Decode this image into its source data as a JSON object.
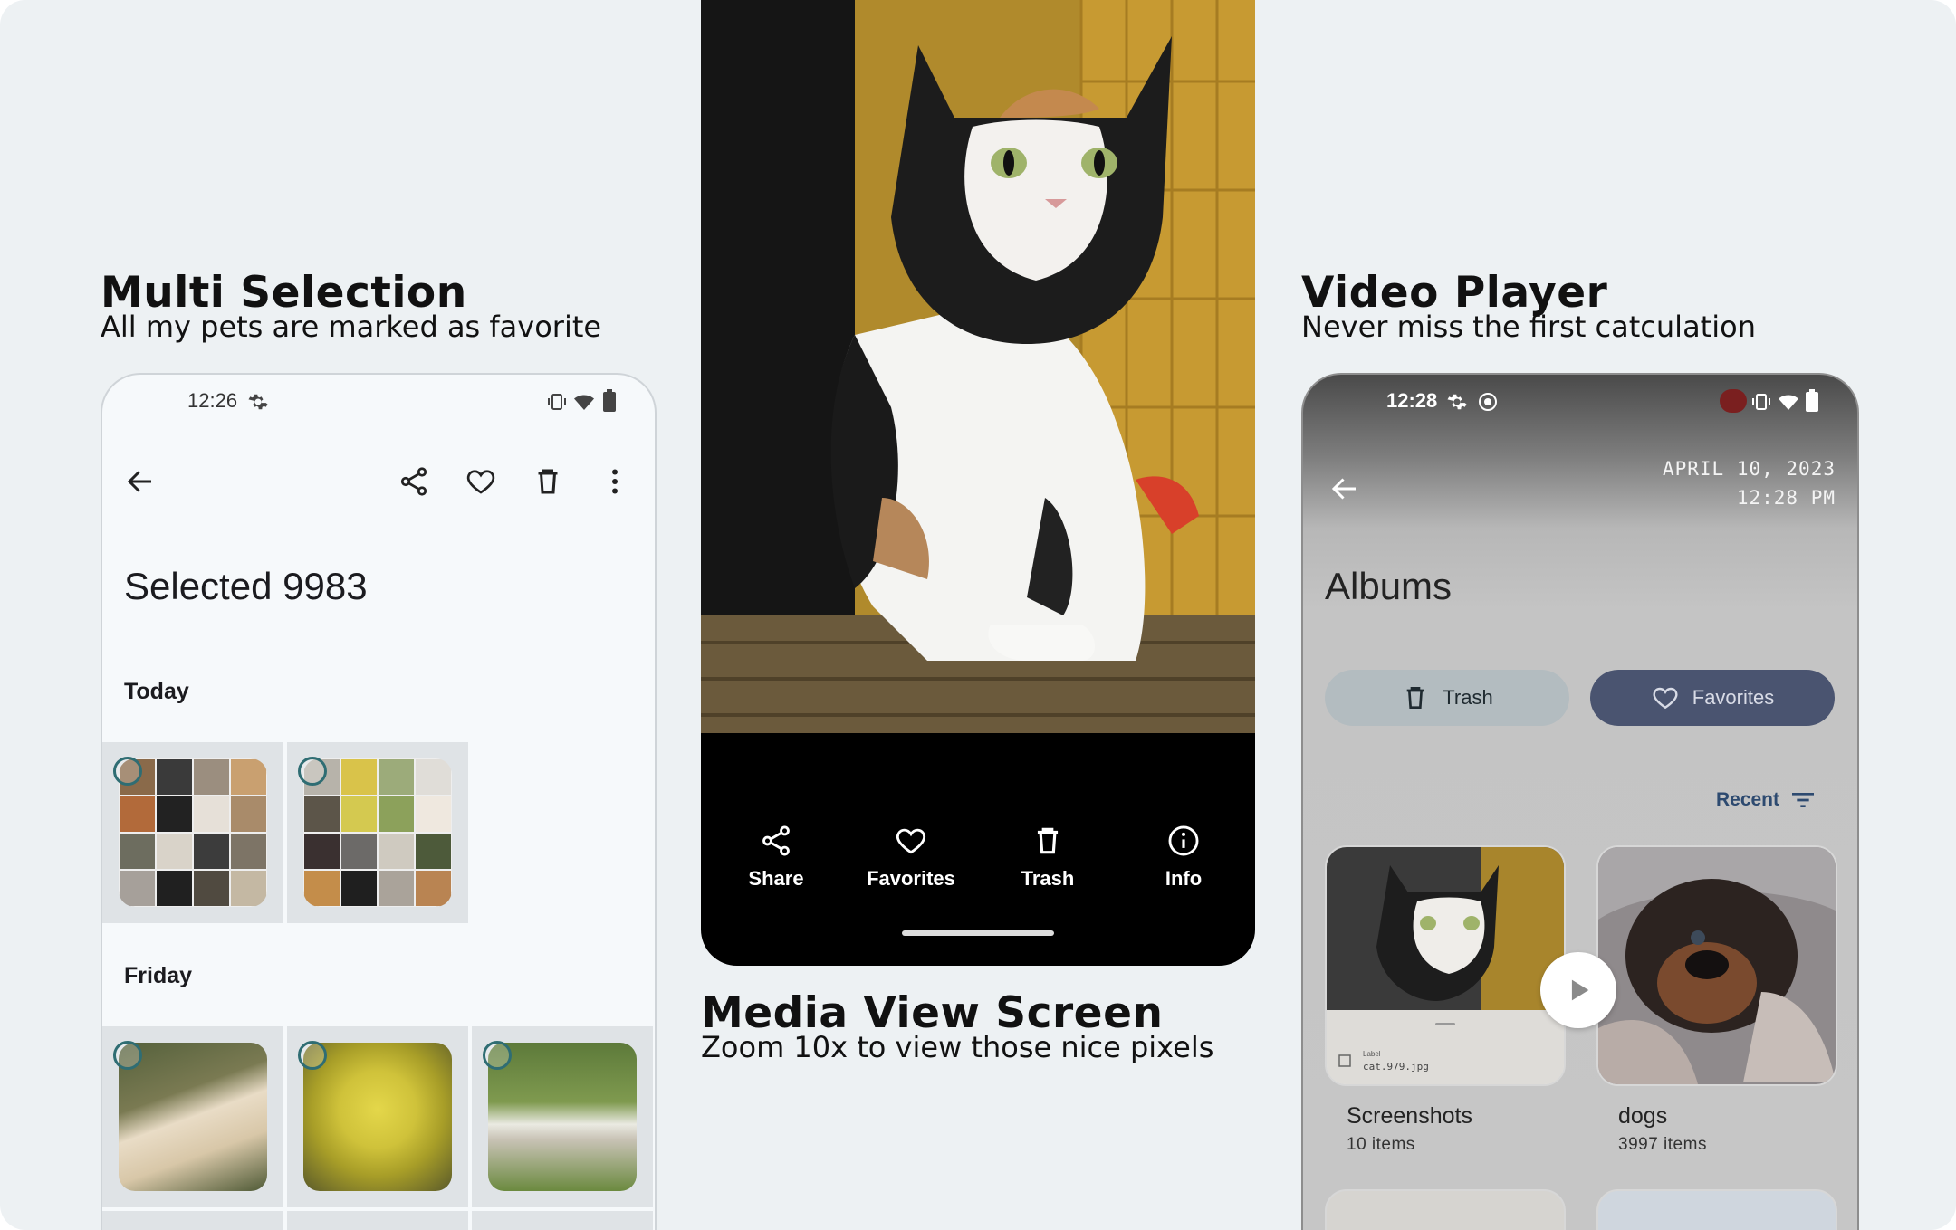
{
  "panels": {
    "left": {
      "title": "Multi Selection",
      "subtitle": "All my pets are marked as favorite"
    },
    "center": {
      "title": "Media View Screen",
      "subtitle": "Zoom 10x to view those nice pixels"
    },
    "right": {
      "title": "Video Player",
      "subtitle": "Never miss the first catculation"
    }
  },
  "selection_screen": {
    "status_time": "12:26",
    "title": "Selected 9983",
    "sections": [
      {
        "label": "Today",
        "items": [
          {
            "name": "pets-collage-1",
            "selected": true
          },
          {
            "name": "pets-collage-2",
            "selected": true
          }
        ]
      },
      {
        "label": "Friday",
        "items": [
          {
            "name": "dog-lab",
            "selected": true
          },
          {
            "name": "dog-yellow",
            "selected": true
          },
          {
            "name": "dog-grass",
            "selected": true
          }
        ]
      }
    ]
  },
  "media_view": {
    "actions": [
      {
        "label": "Share",
        "icon": "share-icon"
      },
      {
        "label": "Favorites",
        "icon": "heart-icon"
      },
      {
        "label": "Trash",
        "icon": "trash-icon"
      },
      {
        "label": "Info",
        "icon": "info-icon"
      }
    ]
  },
  "albums_screen": {
    "status_time": "12:28",
    "date_line1": "APRIL 10, 2023",
    "date_line2": "12:28 PM",
    "title": "Albums",
    "trash_label": "Trash",
    "favorites_label": "Favorites",
    "sort_label": "Recent",
    "screenshot_caption_small": "Label",
    "screenshot_filename": "cat.979.jpg",
    "albums": [
      {
        "name": "Screenshots",
        "count": "10 items"
      },
      {
        "name": "dogs",
        "count": "3997 items"
      }
    ]
  },
  "colors": {
    "background": "#edf1f3",
    "accent": "#2f6d73",
    "favorites_pill": "#4a5470",
    "trash_pill": "#b3bcc0"
  }
}
